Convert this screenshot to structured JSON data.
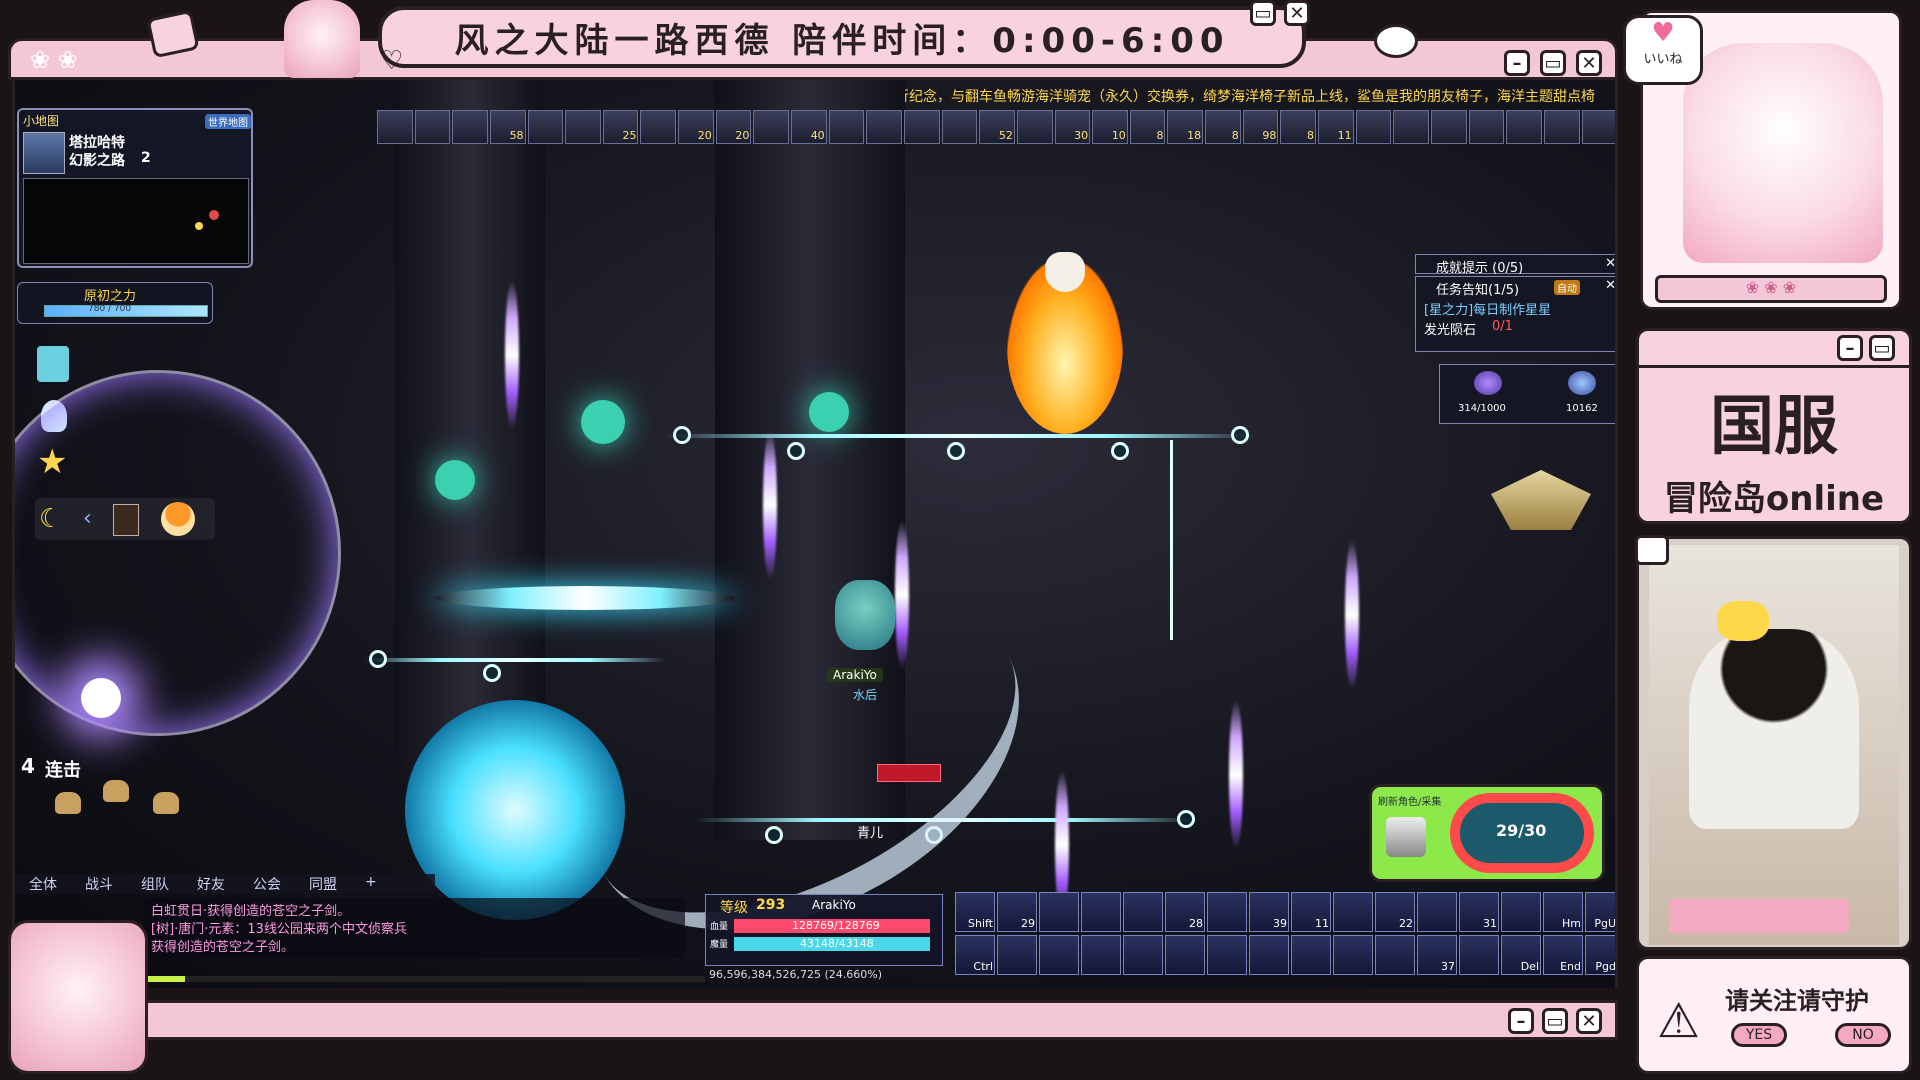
{
  "stream": {
    "title": "风之大陆一路西德  陪伴时间：0:00-6:00",
    "brand_line1": "国服",
    "brand_line2": "冒险岛online",
    "like_label": "いいね",
    "follow_prompt": "请关注请守护",
    "yes_label": "YES",
    "no_label": "NO"
  },
  "game": {
    "marquee": "转蛋万花筒夏日出海旅行纪念，与翻车鱼畅游海洋骑宠（永久）交换券，绮梦海洋椅子新品上线，鲨鱼是我的朋友椅子，海洋主题甜点椅",
    "minimap": {
      "label": "小地图",
      "world_map_button": "世界地图",
      "region": "塔拉哈特",
      "map_name": "幻影之路",
      "map_number": "2"
    },
    "primal_power": {
      "label": "原初之力",
      "value": "780 / 700",
      "fraction": 1.0
    },
    "buffs": [
      "",
      "",
      "",
      "58",
      "",
      "",
      "25",
      "",
      "20",
      "20",
      "",
      "40",
      "",
      "",
      "",
      "",
      "52",
      "",
      "30",
      "10",
      "8",
      "18",
      "8",
      "98",
      "8",
      "11",
      "",
      "",
      "",
      "",
      "",
      "",
      ""
    ],
    "combo": {
      "count": "4",
      "label": "连击"
    },
    "player": {
      "name": "ArakiYo",
      "guild": "水后",
      "npc_label": "青儿"
    },
    "quests": {
      "achievement_title": "成就提示 (0/5)",
      "notice_title": "任务告知(1/5)",
      "auto_tag": "自动",
      "quest_name": "[星之力]每日制作星星",
      "item_name": "发光陨石",
      "item_progress": "0/1"
    },
    "counters": {
      "left": "314/1000",
      "right": "10162"
    },
    "gauge": {
      "label": "刷新角色/采集",
      "value": "29/30",
      "fraction": 0.967
    },
    "chat": {
      "tabs": [
        "全体",
        "战斗",
        "组队",
        "好友",
        "公会",
        "同盟",
        "+"
      ],
      "lines": [
        "白虹贯日·获得创造的苍空之子剑。",
        "[树]·唐门·元素：13线公园来两个中文侦察兵",
        "获得创造的苍空之子剑。"
      ]
    },
    "status": {
      "level_label": "等级",
      "level": "293",
      "name": "ArakiYo",
      "hp_label": "血量",
      "hp": "128769/128769",
      "hp_fraction": 1.0,
      "mp_label": "魔量",
      "mp": "43148/43148",
      "mp_fraction": 1.0,
      "exp": "96,596,384,526,725 (24.660%)",
      "exp_fraction": 0.2466
    },
    "skills_row1": [
      "Shift",
      "29",
      "",
      "",
      "",
      "28",
      "",
      "39",
      "11",
      "",
      "22",
      "",
      "31",
      "",
      "Hm",
      "PgUp"
    ],
    "skills_row2": [
      "Ctrl",
      "",
      "",
      "",
      "",
      "",
      "",
      "",
      "",
      "",
      "",
      "37",
      "",
      "Del",
      "End",
      "Pgdn"
    ]
  },
  "colors": {
    "frame_pink": "#f4c7d8",
    "frame_dark": "#2a2024",
    "hp_red": "#ff4a6e",
    "mp_cyan": "#4ad8e8",
    "gauge_green": "#8de84a"
  }
}
